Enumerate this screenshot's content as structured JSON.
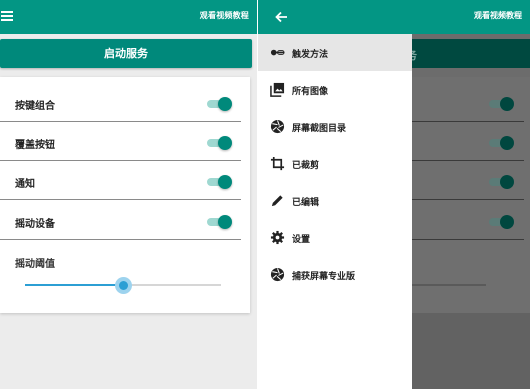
{
  "left": {
    "appbar_title": "观看视频教程",
    "start_button": "启动服务",
    "settings": [
      {
        "label": "按键组合",
        "enabled": true
      },
      {
        "label": "覆盖按钮",
        "enabled": true
      },
      {
        "label": "通知",
        "enabled": true
      },
      {
        "label": "摇动设备",
        "enabled": true
      }
    ],
    "threshold_label": "摇动阈值",
    "threshold_value": 0.5
  },
  "right": {
    "appbar_title": "观看视频教程",
    "start_button_partial": "务",
    "drawer_items": [
      {
        "label": "触发方法",
        "icon": "toggle-icon",
        "active": true
      },
      {
        "label": "所有图像",
        "icon": "photo-library-icon",
        "active": false
      },
      {
        "label": "屏幕截图目录",
        "icon": "camera-aperture-icon",
        "active": false
      },
      {
        "label": "已裁剪",
        "icon": "crop-icon",
        "active": false
      },
      {
        "label": "已编辑",
        "icon": "pencil-icon",
        "active": false
      },
      {
        "label": "设置",
        "icon": "gear-icon",
        "active": false
      },
      {
        "label": "捕获屏幕专业版",
        "icon": "camera-aperture-icon",
        "active": false
      }
    ]
  },
  "colors": {
    "primary": "#039684",
    "accent": "#00897b",
    "slider": "#2c9fd4"
  }
}
